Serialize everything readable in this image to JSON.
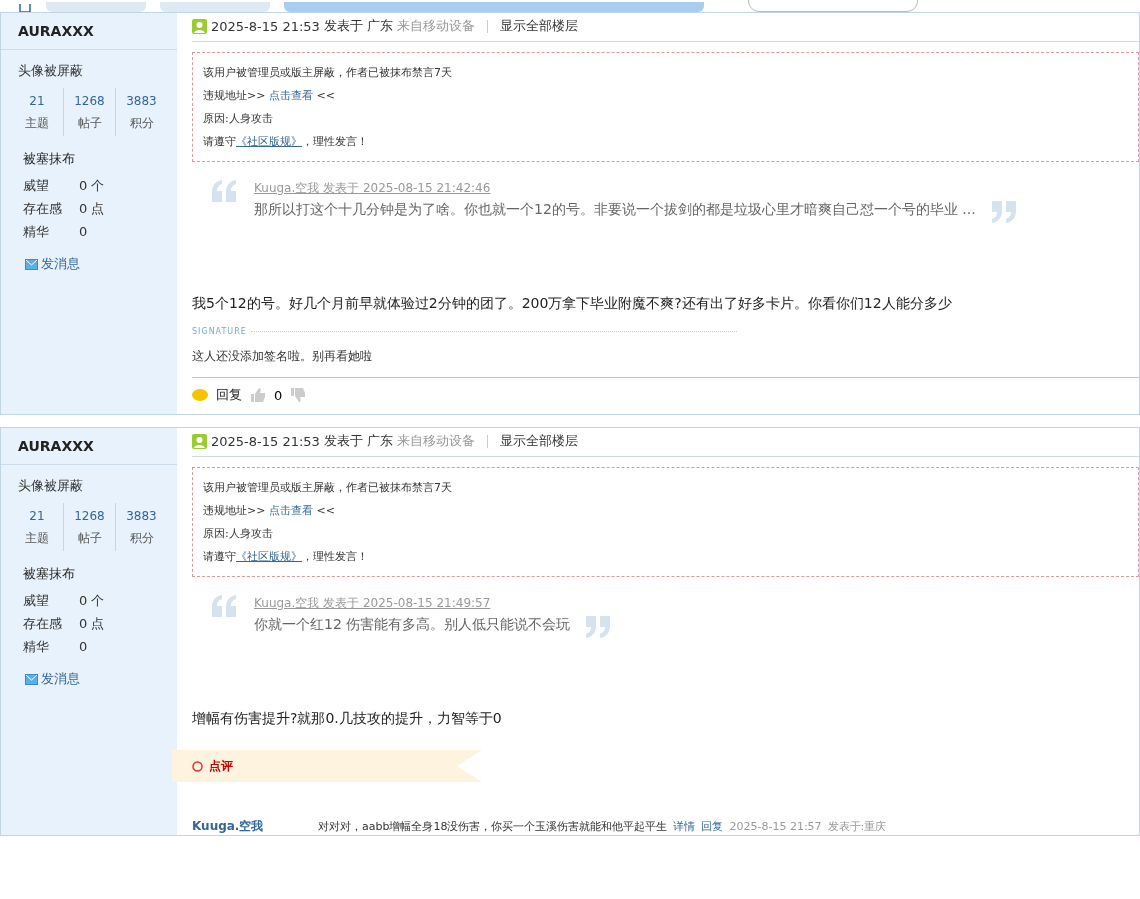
{
  "posts": [
    {
      "author": "AURAXXX",
      "avatar_note": "头像被屏蔽",
      "stats": [
        {
          "value": "21",
          "label": "主题"
        },
        {
          "value": "1268",
          "label": "帖子"
        },
        {
          "value": "3883",
          "label": "积分"
        }
      ],
      "group": "被塞抹布",
      "details": [
        {
          "label": "威望",
          "value": "0 个"
        },
        {
          "label": "存在感",
          "value": "0 点"
        },
        {
          "label": "精华",
          "value": "0"
        }
      ],
      "message_link": "发消息",
      "meta": {
        "date": "2025-8-15 21:53",
        "posted_in": "发表于 广东",
        "device": "来自移动设备",
        "show_all": "显示全部楼层"
      },
      "notice": {
        "line1": "该用户被管理员或版主屏蔽，作者已被抹布禁言7天",
        "addr_label": "违规地址>>",
        "addr_link": "点击查看",
        "addr_end": "<<",
        "reason": "原因:人身攻击",
        "rule_pre": "请遵守",
        "rule_link": "《社区版规》",
        "rule_post": "，理性发言！"
      },
      "quote": {
        "byline": "Kuuga.空我 发表于 2025-08-15 21:42:46",
        "text": "那所以打这个十几分钟是为了啥。你也就一个12的号。非要说一个拔剑的都是垃圾心里才暗爽自己怼一个号的毕业 ..."
      },
      "body": "我5个12的号。好几个月前早就体验过2分钟的团了。200万拿下毕业附魔不爽?还有出了好多卡片。你看你们12人能分多少",
      "signature_label": "SIGNATURE",
      "signature": "这人还没添加签名啦。别再看她啦",
      "actions": {
        "reply": "回复",
        "likes": "0"
      }
    },
    {
      "author": "AURAXXX",
      "avatar_note": "头像被屏蔽",
      "stats": [
        {
          "value": "21",
          "label": "主题"
        },
        {
          "value": "1268",
          "label": "帖子"
        },
        {
          "value": "3883",
          "label": "积分"
        }
      ],
      "group": "被塞抹布",
      "details": [
        {
          "label": "威望",
          "value": "0 个"
        },
        {
          "label": "存在感",
          "value": "0 点"
        },
        {
          "label": "精华",
          "value": "0"
        }
      ],
      "message_link": "发消息",
      "meta": {
        "date": "2025-8-15 21:53",
        "posted_in": "发表于 广东",
        "device": "来自移动设备",
        "show_all": "显示全部楼层"
      },
      "notice": {
        "line1": "该用户被管理员或版主屏蔽，作者已被抹布禁言7天",
        "addr_label": "违规地址>>",
        "addr_link": "点击查看",
        "addr_end": "<<",
        "reason": "原因:人身攻击",
        "rule_pre": "请遵守",
        "rule_link": "《社区版规》",
        "rule_post": "，理性发言！"
      },
      "quote": {
        "byline": "Kuuga.空我 发表于 2025-08-15 21:49:57",
        "text": "你就一个红12 伤害能有多高。别人低只能说不会玩"
      },
      "body": "增幅有伤害提升?就那0.几技攻的提升，力智等于0",
      "comments_title": "点评",
      "comment": {
        "author": "Kuuga.空我",
        "text": "对对对，aabb增幅全身18没伤害，你买一个玉溪伤害就能和他平起平生",
        "detail": "详情",
        "reply": "回复",
        "time": "2025-8-15 21:57",
        "place": "发表于:重庆"
      }
    }
  ],
  "breadcrumb": [
    {
      "selected": false
    },
    {
      "selected": false
    },
    {
      "selected": true
    }
  ]
}
